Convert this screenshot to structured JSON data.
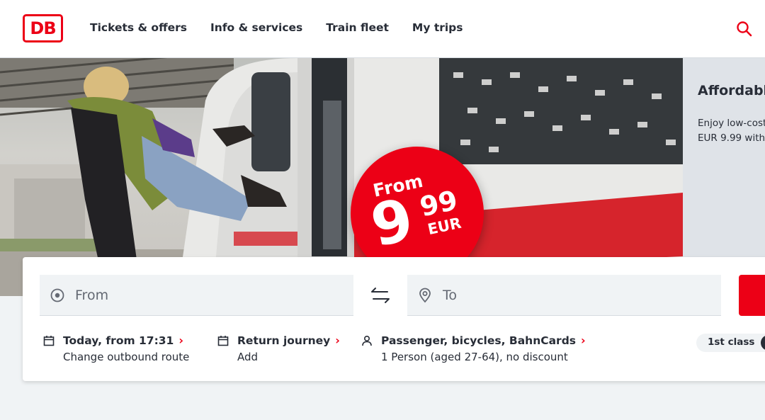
{
  "header": {
    "logo": "DB",
    "nav": [
      "Tickets & offers",
      "Info & services",
      "Train fleet",
      "My trips"
    ]
  },
  "hero": {
    "promo": {
      "from": "From",
      "price_main": "9",
      "price_cents": "99",
      "currency": "EUR"
    }
  },
  "teaser": {
    "title": "Affordabl",
    "text_line1": "Enjoy low-cost",
    "text_line2": "EUR 9.99 with"
  },
  "search": {
    "from_placeholder": "From",
    "to_placeholder": "To",
    "options": [
      {
        "title": "Today, from 17:31",
        "sub": "Change outbound route",
        "icon": "calendar-icon"
      },
      {
        "title": "Return journey",
        "sub": "Add",
        "icon": "calendar-icon"
      },
      {
        "title": "Passenger, bicycles, BahnCards",
        "sub": "1 Person (aged 27-64), no discount",
        "icon": "person-icon"
      }
    ],
    "class_label": "1st class"
  },
  "colors": {
    "brand_red": "#ec0016",
    "text": "#282d37",
    "background": "#f0f3f5"
  }
}
